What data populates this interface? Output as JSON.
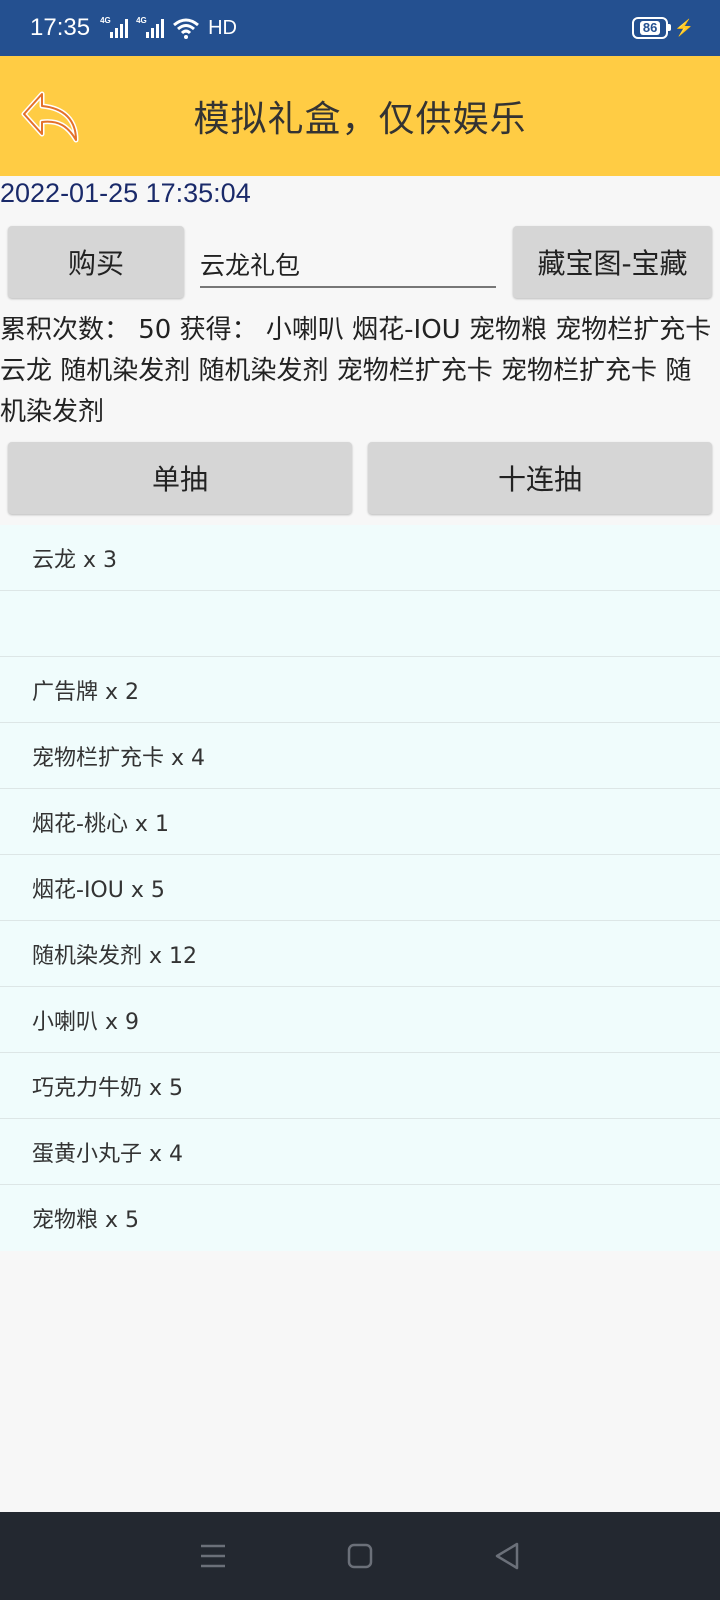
{
  "status_bar": {
    "time": "17:35",
    "network_1": "4G",
    "network_2": "4G",
    "hd": "HD",
    "battery_level": "86",
    "icons": [
      "signal-icon",
      "wifi-icon",
      "battery-icon",
      "charging-icon"
    ]
  },
  "header": {
    "title": "模拟礼盒，仅供娱乐",
    "bg_color": "#ffcc44"
  },
  "datetime": "2022-01-25 17:35:04",
  "actions": {
    "buy_label": "购买",
    "pack_value": "云龙礼包",
    "treasure_label": "藏宝图-宝藏",
    "single_draw_label": "单抽",
    "ten_draw_label": "十连抽"
  },
  "summary": {
    "text": "累积次数：  50 获得：  小喇叭 烟花-IOU 宠物粮 宠物栏扩充卡 云龙 随机染发剂 随机染发剂 宠物栏扩充卡 宠物栏扩充卡 随机染发剂"
  },
  "results": [
    "云龙 x 3",
    "",
    "广告牌 x 2",
    "宠物栏扩充卡 x 4",
    "烟花-桃心 x 1",
    "烟花-IOU x 5",
    "随机染发剂 x 12",
    "小喇叭 x 9",
    "巧克力牛奶 x 5",
    "蛋黄小丸子 x 4",
    "宠物粮 x 5"
  ]
}
